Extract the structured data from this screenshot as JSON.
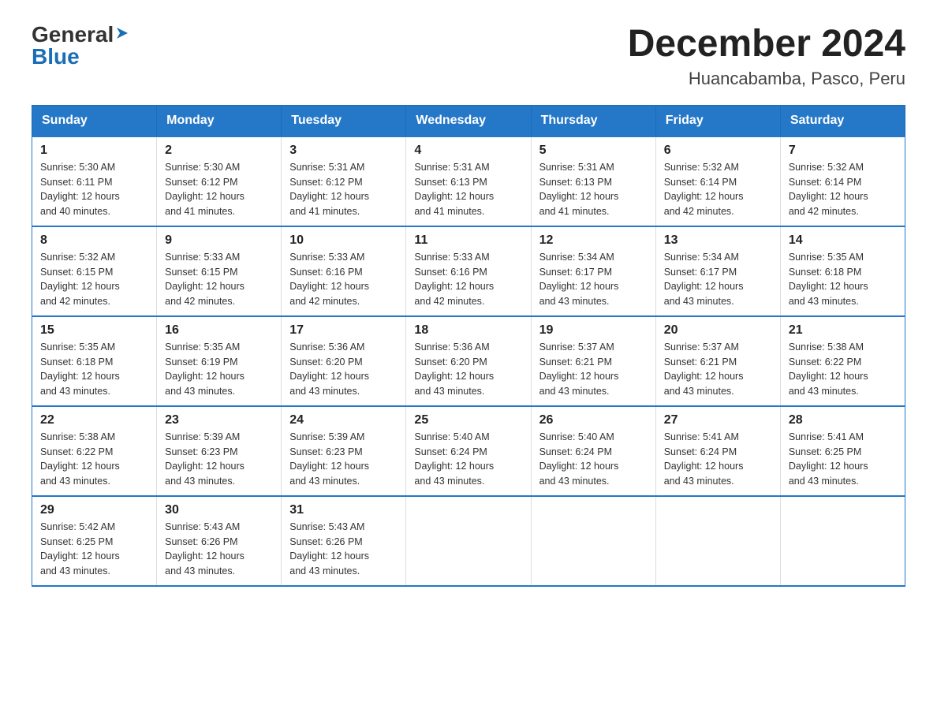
{
  "logo": {
    "general": "General",
    "blue": "Blue",
    "arrow": "▶"
  },
  "title": "December 2024",
  "location": "Huancabamba, Pasco, Peru",
  "days_of_week": [
    "Sunday",
    "Monday",
    "Tuesday",
    "Wednesday",
    "Thursday",
    "Friday",
    "Saturday"
  ],
  "weeks": [
    [
      {
        "day": "1",
        "sunrise": "5:30 AM",
        "sunset": "6:11 PM",
        "daylight": "12 hours and 40 minutes."
      },
      {
        "day": "2",
        "sunrise": "5:30 AM",
        "sunset": "6:12 PM",
        "daylight": "12 hours and 41 minutes."
      },
      {
        "day": "3",
        "sunrise": "5:31 AM",
        "sunset": "6:12 PM",
        "daylight": "12 hours and 41 minutes."
      },
      {
        "day": "4",
        "sunrise": "5:31 AM",
        "sunset": "6:13 PM",
        "daylight": "12 hours and 41 minutes."
      },
      {
        "day": "5",
        "sunrise": "5:31 AM",
        "sunset": "6:13 PM",
        "daylight": "12 hours and 41 minutes."
      },
      {
        "day": "6",
        "sunrise": "5:32 AM",
        "sunset": "6:14 PM",
        "daylight": "12 hours and 42 minutes."
      },
      {
        "day": "7",
        "sunrise": "5:32 AM",
        "sunset": "6:14 PM",
        "daylight": "12 hours and 42 minutes."
      }
    ],
    [
      {
        "day": "8",
        "sunrise": "5:32 AM",
        "sunset": "6:15 PM",
        "daylight": "12 hours and 42 minutes."
      },
      {
        "day": "9",
        "sunrise": "5:33 AM",
        "sunset": "6:15 PM",
        "daylight": "12 hours and 42 minutes."
      },
      {
        "day": "10",
        "sunrise": "5:33 AM",
        "sunset": "6:16 PM",
        "daylight": "12 hours and 42 minutes."
      },
      {
        "day": "11",
        "sunrise": "5:33 AM",
        "sunset": "6:16 PM",
        "daylight": "12 hours and 42 minutes."
      },
      {
        "day": "12",
        "sunrise": "5:34 AM",
        "sunset": "6:17 PM",
        "daylight": "12 hours and 43 minutes."
      },
      {
        "day": "13",
        "sunrise": "5:34 AM",
        "sunset": "6:17 PM",
        "daylight": "12 hours and 43 minutes."
      },
      {
        "day": "14",
        "sunrise": "5:35 AM",
        "sunset": "6:18 PM",
        "daylight": "12 hours and 43 minutes."
      }
    ],
    [
      {
        "day": "15",
        "sunrise": "5:35 AM",
        "sunset": "6:18 PM",
        "daylight": "12 hours and 43 minutes."
      },
      {
        "day": "16",
        "sunrise": "5:35 AM",
        "sunset": "6:19 PM",
        "daylight": "12 hours and 43 minutes."
      },
      {
        "day": "17",
        "sunrise": "5:36 AM",
        "sunset": "6:20 PM",
        "daylight": "12 hours and 43 minutes."
      },
      {
        "day": "18",
        "sunrise": "5:36 AM",
        "sunset": "6:20 PM",
        "daylight": "12 hours and 43 minutes."
      },
      {
        "day": "19",
        "sunrise": "5:37 AM",
        "sunset": "6:21 PM",
        "daylight": "12 hours and 43 minutes."
      },
      {
        "day": "20",
        "sunrise": "5:37 AM",
        "sunset": "6:21 PM",
        "daylight": "12 hours and 43 minutes."
      },
      {
        "day": "21",
        "sunrise": "5:38 AM",
        "sunset": "6:22 PM",
        "daylight": "12 hours and 43 minutes."
      }
    ],
    [
      {
        "day": "22",
        "sunrise": "5:38 AM",
        "sunset": "6:22 PM",
        "daylight": "12 hours and 43 minutes."
      },
      {
        "day": "23",
        "sunrise": "5:39 AM",
        "sunset": "6:23 PM",
        "daylight": "12 hours and 43 minutes."
      },
      {
        "day": "24",
        "sunrise": "5:39 AM",
        "sunset": "6:23 PM",
        "daylight": "12 hours and 43 minutes."
      },
      {
        "day": "25",
        "sunrise": "5:40 AM",
        "sunset": "6:24 PM",
        "daylight": "12 hours and 43 minutes."
      },
      {
        "day": "26",
        "sunrise": "5:40 AM",
        "sunset": "6:24 PM",
        "daylight": "12 hours and 43 minutes."
      },
      {
        "day": "27",
        "sunrise": "5:41 AM",
        "sunset": "6:24 PM",
        "daylight": "12 hours and 43 minutes."
      },
      {
        "day": "28",
        "sunrise": "5:41 AM",
        "sunset": "6:25 PM",
        "daylight": "12 hours and 43 minutes."
      }
    ],
    [
      {
        "day": "29",
        "sunrise": "5:42 AM",
        "sunset": "6:25 PM",
        "daylight": "12 hours and 43 minutes."
      },
      {
        "day": "30",
        "sunrise": "5:43 AM",
        "sunset": "6:26 PM",
        "daylight": "12 hours and 43 minutes."
      },
      {
        "day": "31",
        "sunrise": "5:43 AM",
        "sunset": "6:26 PM",
        "daylight": "12 hours and 43 minutes."
      },
      null,
      null,
      null,
      null
    ]
  ],
  "labels": {
    "sunrise_prefix": "Sunrise: ",
    "sunset_prefix": "Sunset: ",
    "daylight_prefix": "Daylight: "
  },
  "colors": {
    "header_bg": "#2577c8",
    "header_text": "#ffffff",
    "border": "#2577c8",
    "text_dark": "#222222",
    "blue_logo": "#1a6eb5"
  }
}
